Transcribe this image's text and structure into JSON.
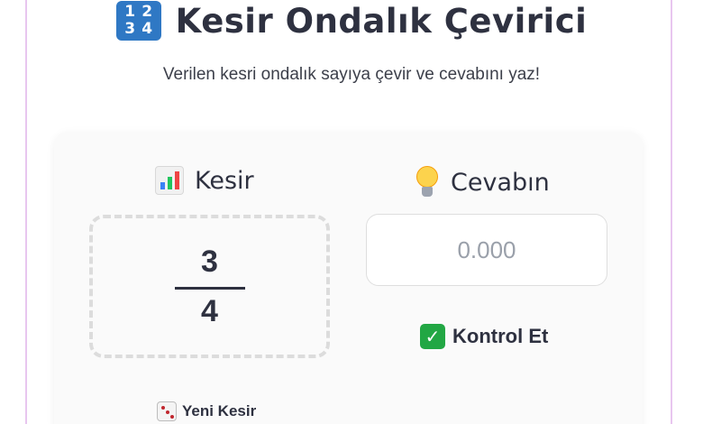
{
  "header": {
    "title": "Kesir Ondalık Çevirici",
    "title_icon": "input-numbers-icon",
    "title_icon_digits": [
      "1",
      "2",
      "3",
      "4"
    ],
    "subtitle": "Verilen kesri ondalık sayıya çevir ve cevabını yaz!"
  },
  "fraction_section": {
    "label": "Kesir",
    "icon": "bar-chart-icon",
    "numerator": "3",
    "denominator": "4"
  },
  "answer_section": {
    "label": "Cevabın",
    "icon": "light-bulb-icon",
    "input_value": "",
    "input_placeholder": "0.000"
  },
  "actions": {
    "check_label": "Kontrol Et",
    "check_icon": "check-mark-icon",
    "new_label": "Yeni Kesir",
    "new_icon": "dice-icon"
  },
  "colors": {
    "frame_border": "#e8c6ef",
    "text": "#2e3140",
    "card_bg": "#fafafa",
    "check_green": "#22a744"
  }
}
